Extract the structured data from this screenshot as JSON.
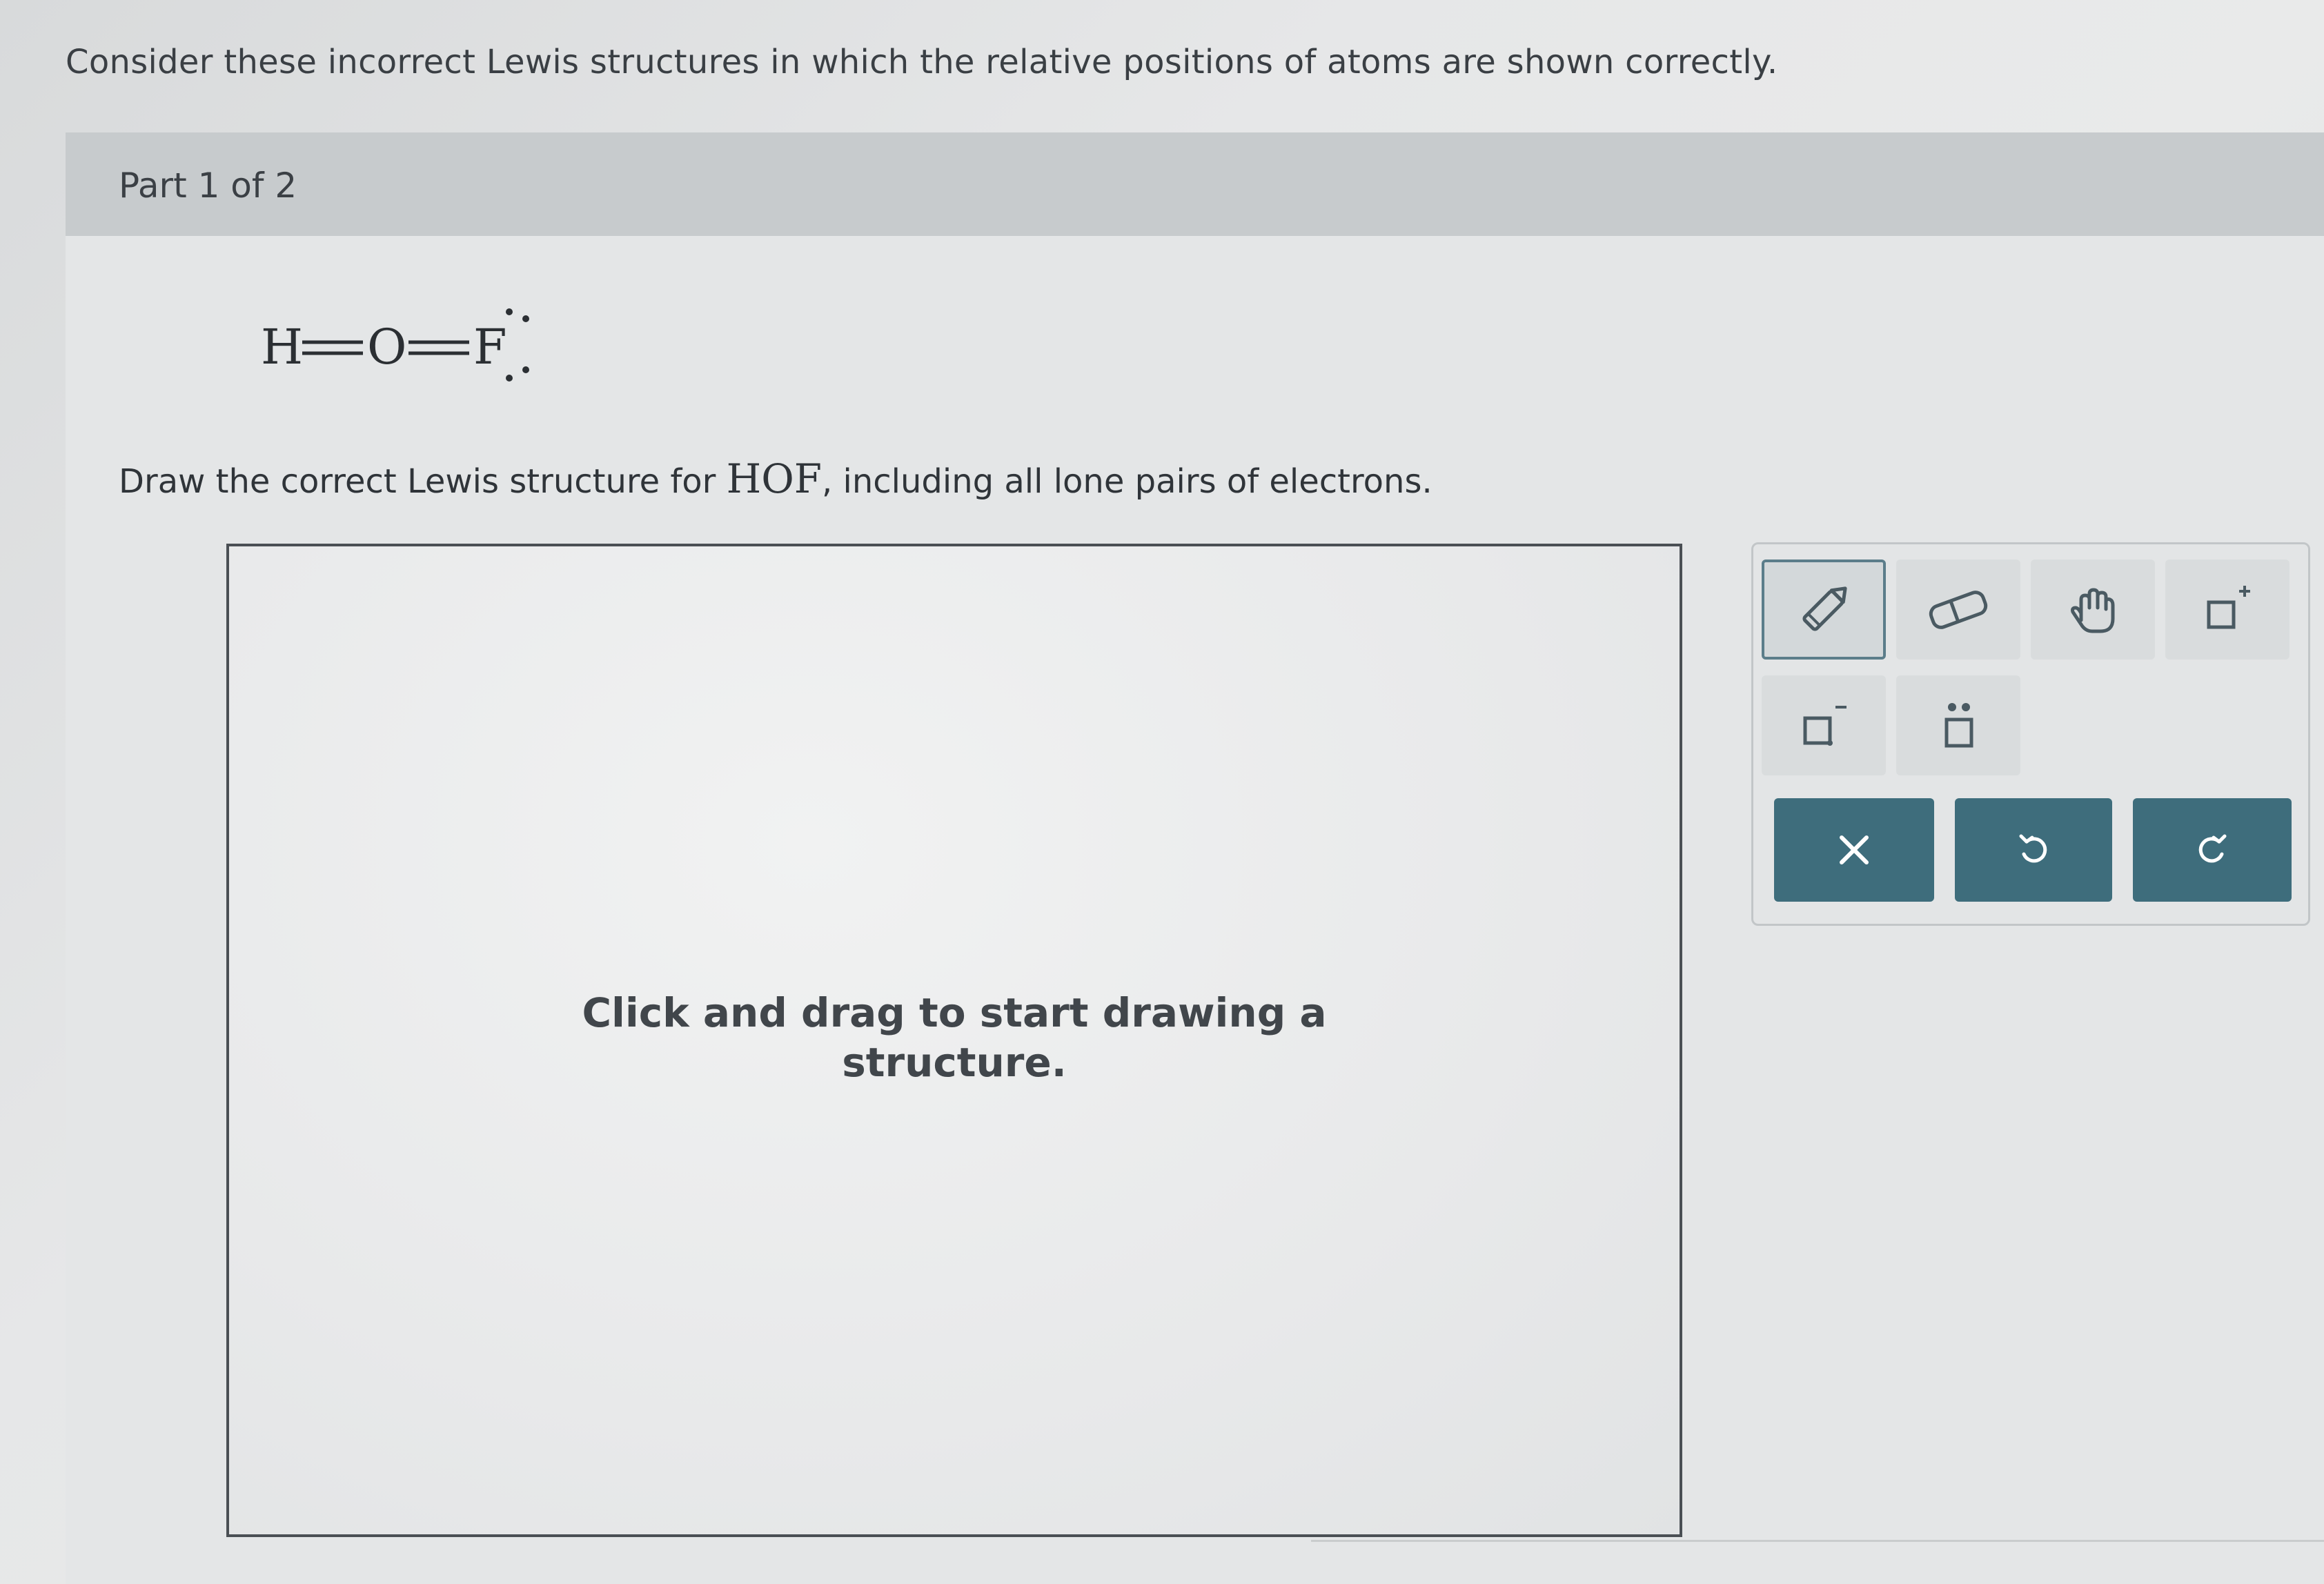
{
  "question": {
    "intro": "Consider these incorrect Lewis structures in which the relative positions of atoms are shown correctly."
  },
  "part": {
    "label": "Part 1 of 2"
  },
  "incorrect_structure": {
    "atoms": [
      "H",
      "O",
      "F"
    ],
    "bond_symbol": "="
  },
  "instruction": {
    "before": "Draw the correct Lewis structure for ",
    "formula": "HOF",
    "after": ", including all lone pairs of electrons."
  },
  "canvas": {
    "hint_line1": "Click and drag to start drawing a",
    "hint_line2": "structure."
  },
  "toolbar": {
    "tools": [
      {
        "icon": "pencil-icon",
        "active": true
      },
      {
        "icon": "eraser-icon",
        "active": false
      },
      {
        "icon": "hand-icon",
        "active": false
      },
      {
        "icon": "positive-charge-icon",
        "active": false
      },
      {
        "icon": "negative-charge-icon",
        "active": false
      },
      {
        "icon": "lone-pair-icon",
        "active": false
      }
    ],
    "actions": [
      {
        "icon": "clear-icon"
      },
      {
        "icon": "undo-icon"
      },
      {
        "icon": "redo-icon"
      }
    ]
  },
  "colors": {
    "action_button": "#3e6d7c",
    "active_tool_border": "#5b7d8a",
    "part_header": "#c7cbcd"
  }
}
